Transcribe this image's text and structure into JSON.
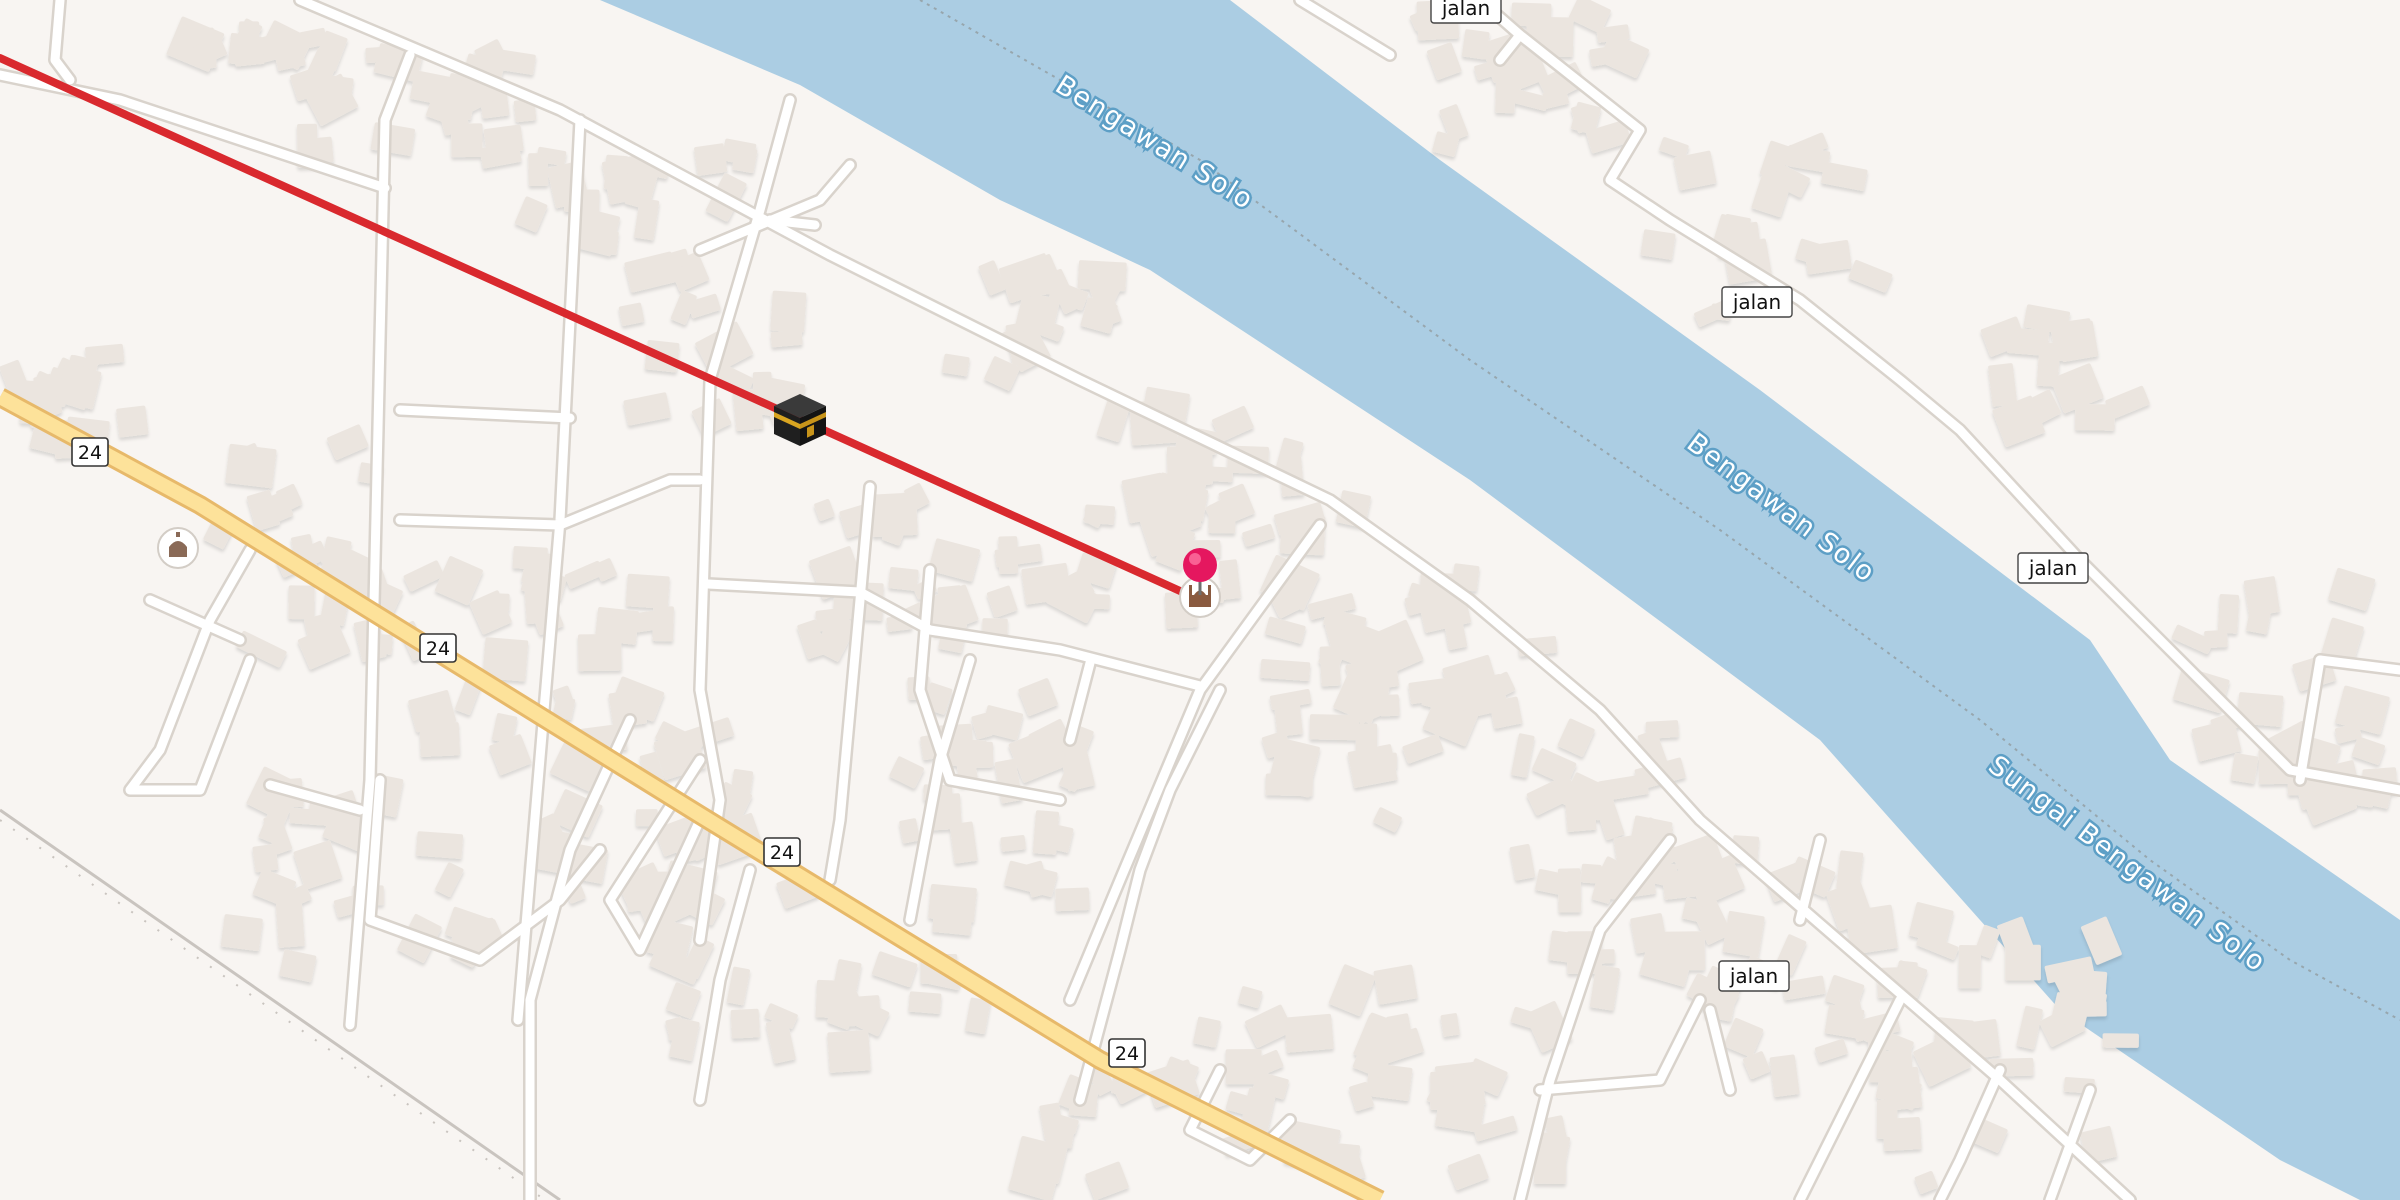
{
  "map": {
    "colors": {
      "land": "#f8f5f2",
      "water": "#abcde3",
      "building": "#ebe5df",
      "minor_road": "#ffffff",
      "minor_road_casing": "#d9d3cc",
      "primary_road": "#fde29a",
      "primary_road_casing": "#e7b96a",
      "qibla_line": "#d9292e",
      "pin": "#e5175f",
      "railway": "#c9c4bf"
    },
    "waterway_labels": [
      {
        "text": "Bengawan Solo"
      },
      {
        "text": "Bengawan Solo"
      },
      {
        "text": "Sungai Bengawan Solo"
      }
    ],
    "road_shields": [
      {
        "ref": "24"
      },
      {
        "ref": "24"
      },
      {
        "ref": "24"
      },
      {
        "ref": "24"
      }
    ],
    "street_labels": [
      {
        "name": "jalan"
      },
      {
        "name": "jalan"
      },
      {
        "name": "jalan"
      },
      {
        "name": "jalan"
      }
    ],
    "markers": {
      "kaaba": {
        "icon": "kaaba-icon"
      },
      "location_pin": {
        "icon": "location-pin-icon"
      },
      "mosque_poi_1": {
        "icon": "mosque-icon"
      },
      "mosque_poi_2": {
        "icon": "mosque-icon"
      }
    },
    "qibla_line": {
      "visible": true
    }
  }
}
